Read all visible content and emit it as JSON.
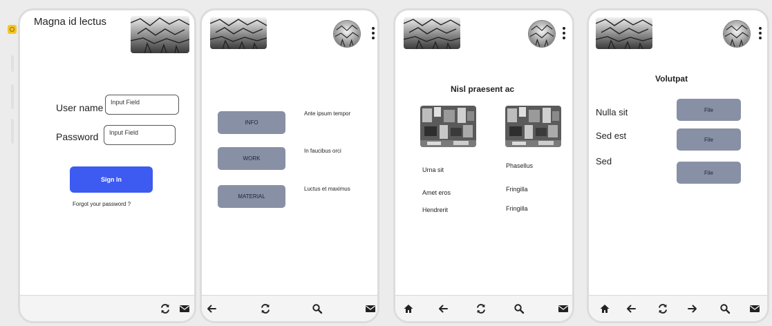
{
  "screens": {
    "signin": {
      "title": "Magna id lectus",
      "username_label": "User name",
      "username_placeholder": "Input Field",
      "password_label": "Password",
      "password_placeholder": "Input Field",
      "signin_button": "Sign In",
      "forgot_link": "Forgot your password ?",
      "footer_icons": [
        "refresh-icon",
        "mail-icon"
      ]
    },
    "menu": {
      "items": [
        {
          "button": "INFO",
          "description": "Ante ipsum tempor"
        },
        {
          "button": "WORK",
          "description": "In faucibus orci"
        },
        {
          "button": "MATERIAL",
          "description": "Luctus et maximus"
        }
      ],
      "footer_icons": [
        "back-arrow-icon",
        "refresh-icon",
        "search-icon",
        "mail-icon"
      ]
    },
    "gallery": {
      "title": "Nisl praesent ac",
      "left_labels": [
        "Urna sit",
        "Amet eros",
        "Hendrerit"
      ],
      "right_labels": [
        "Phasellus",
        "Fringilla",
        "Fringilla"
      ],
      "footer_icons": [
        "home-icon",
        "back-arrow-icon",
        "refresh-icon",
        "search-icon",
        "mail-icon"
      ]
    },
    "files": {
      "title": "Volutpat",
      "rows": [
        {
          "label": "Nulla sit",
          "button": "File"
        },
        {
          "label": "Sed est",
          "button": "File"
        },
        {
          "label": "Sed",
          "button": "File"
        }
      ],
      "footer_icons": [
        "home-icon",
        "back-arrow-icon",
        "refresh-icon",
        "forward-arrow-icon",
        "search-icon",
        "mail-icon"
      ]
    }
  },
  "colors": {
    "primary_button": "#3d5af1",
    "secondary_button": "#8890a6",
    "screen_background": "#ffffff",
    "page_background": "#ececec"
  }
}
